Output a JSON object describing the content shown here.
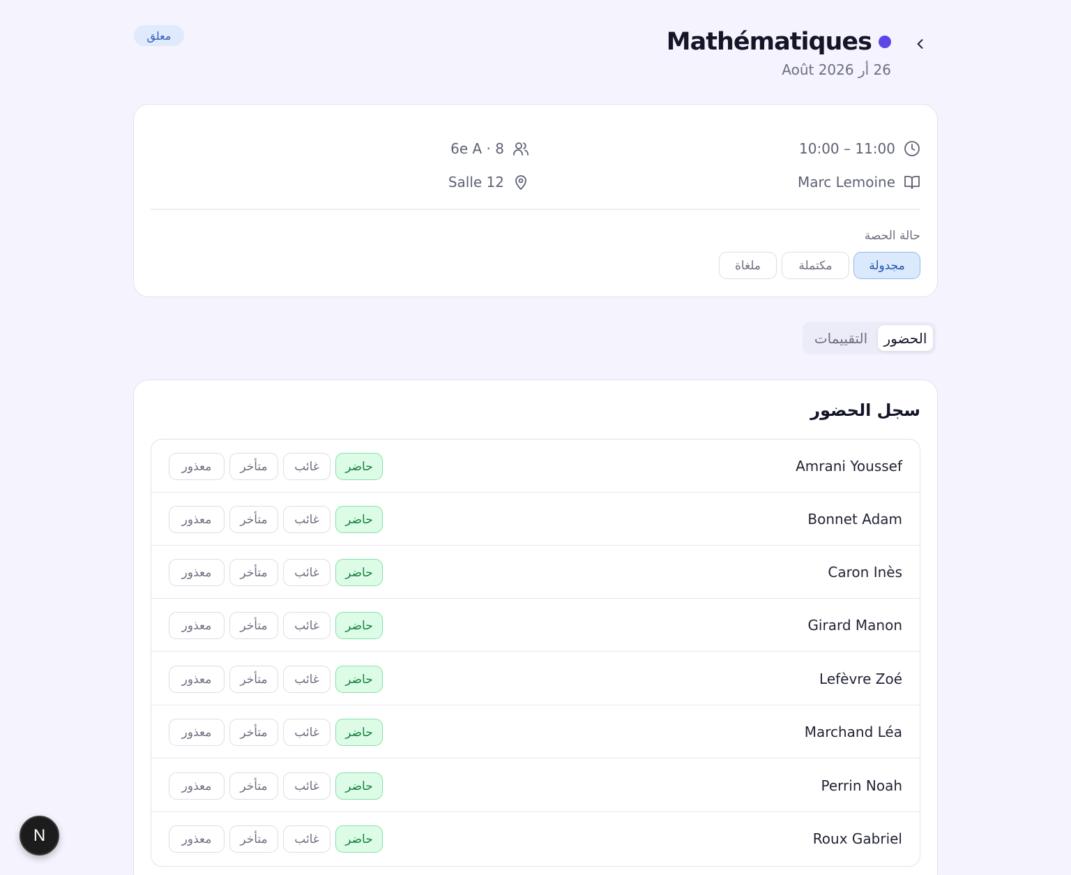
{
  "header": {
    "title": "Mathématiques",
    "date": "26 أر Août 2026",
    "status_badge": "معلق",
    "accent_color": "#5b47e6",
    "back_icon": "chevron-right-icon"
  },
  "info": {
    "time": "10:00 – 11:00",
    "group": "6e A · 8",
    "teacher": "Marc Lemoine",
    "room": "Salle 12",
    "status_label": "حالة الحصة",
    "status_options": [
      "مجدولة",
      "مكتملة",
      "ملغاة"
    ],
    "status_selected": "مجدولة"
  },
  "tabs": {
    "attendance": "الحضور",
    "evaluations": "التقييمات"
  },
  "attendance": {
    "title": "سجل الحضور",
    "options": {
      "present": "حاضر",
      "absent": "غائب",
      "late": "متأخر",
      "excused": "معذور"
    },
    "students": [
      {
        "name": "Amrani Youssef",
        "status": "present"
      },
      {
        "name": "Bonnet Adam",
        "status": "present"
      },
      {
        "name": "Caron Inès",
        "status": "present"
      },
      {
        "name": "Girard Manon",
        "status": "present"
      },
      {
        "name": "Lefèvre Zoé",
        "status": "present"
      },
      {
        "name": "Marchand Léa",
        "status": "present"
      },
      {
        "name": "Perrin Noah",
        "status": "present"
      },
      {
        "name": "Roux Gabriel",
        "status": "present"
      }
    ]
  },
  "fab": {
    "label": "N"
  }
}
